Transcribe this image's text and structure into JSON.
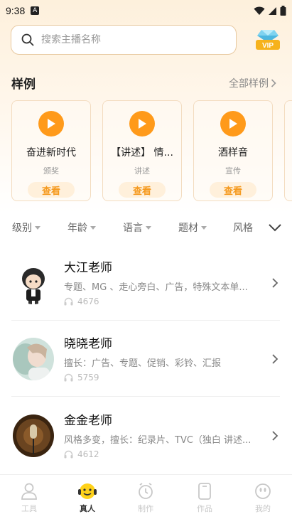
{
  "status_bar": {
    "time": "9:38",
    "app_icon": "A"
  },
  "search": {
    "placeholder": "搜索主播名称"
  },
  "vip_icon": "vip-diamond-icon",
  "samples": {
    "title": "样例",
    "more": "全部样例",
    "cards": [
      {
        "name": "奋进新时代",
        "tag": "颁奖",
        "button": "查看"
      },
      {
        "name": "【讲述】 情...",
        "tag": "讲述",
        "button": "查看"
      },
      {
        "name": "酒样音",
        "tag": "宣传",
        "button": "查看"
      }
    ]
  },
  "filters": [
    {
      "label": "级别"
    },
    {
      "label": "年龄"
    },
    {
      "label": "语言"
    },
    {
      "label": "题材"
    },
    {
      "label": "风格"
    }
  ],
  "teachers": [
    {
      "name": "大江老师",
      "desc": "专题、MG 、走心旁白、广告，特殊文本单...",
      "plays": "4676"
    },
    {
      "name": "晓晓老师",
      "desc": "擅长：广告、专题、促销、彩铃、汇报",
      "plays": "5759"
    },
    {
      "name": "金金老师",
      "desc": "风格多变，擅长：纪录片、TVC（独白 讲述...",
      "plays": "4612"
    }
  ],
  "tabbar": {
    "tabs": [
      {
        "label": "工具"
      },
      {
        "label": "真人"
      },
      {
        "label": "制作"
      },
      {
        "label": "作品"
      },
      {
        "label": "我的"
      }
    ]
  },
  "colors": {
    "accent": "#ff9a1a",
    "active_tab": "#333333",
    "inactive_tab": "#c8c8c8"
  }
}
